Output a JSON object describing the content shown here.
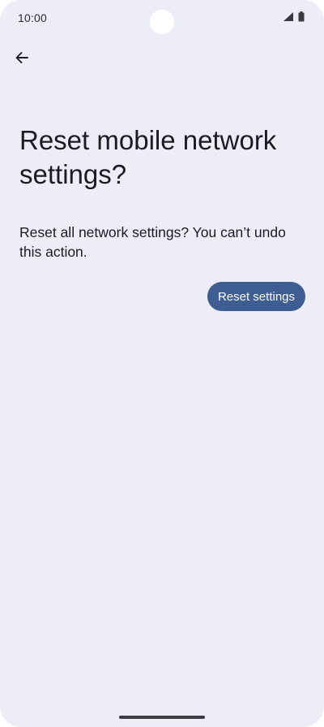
{
  "status_bar": {
    "time": "10:00",
    "icons": [
      "signal-icon",
      "battery-icon"
    ]
  },
  "toolbar": {
    "back_icon": "arrow-left-icon"
  },
  "main": {
    "title": "Reset mobile network settings?",
    "description": "Reset all network settings? You can’t undo this action.",
    "reset_button_label": "Reset settings"
  },
  "colors": {
    "background": "#ecedf6",
    "primary_button": "#3e5d93",
    "text": "#1b1c22"
  }
}
